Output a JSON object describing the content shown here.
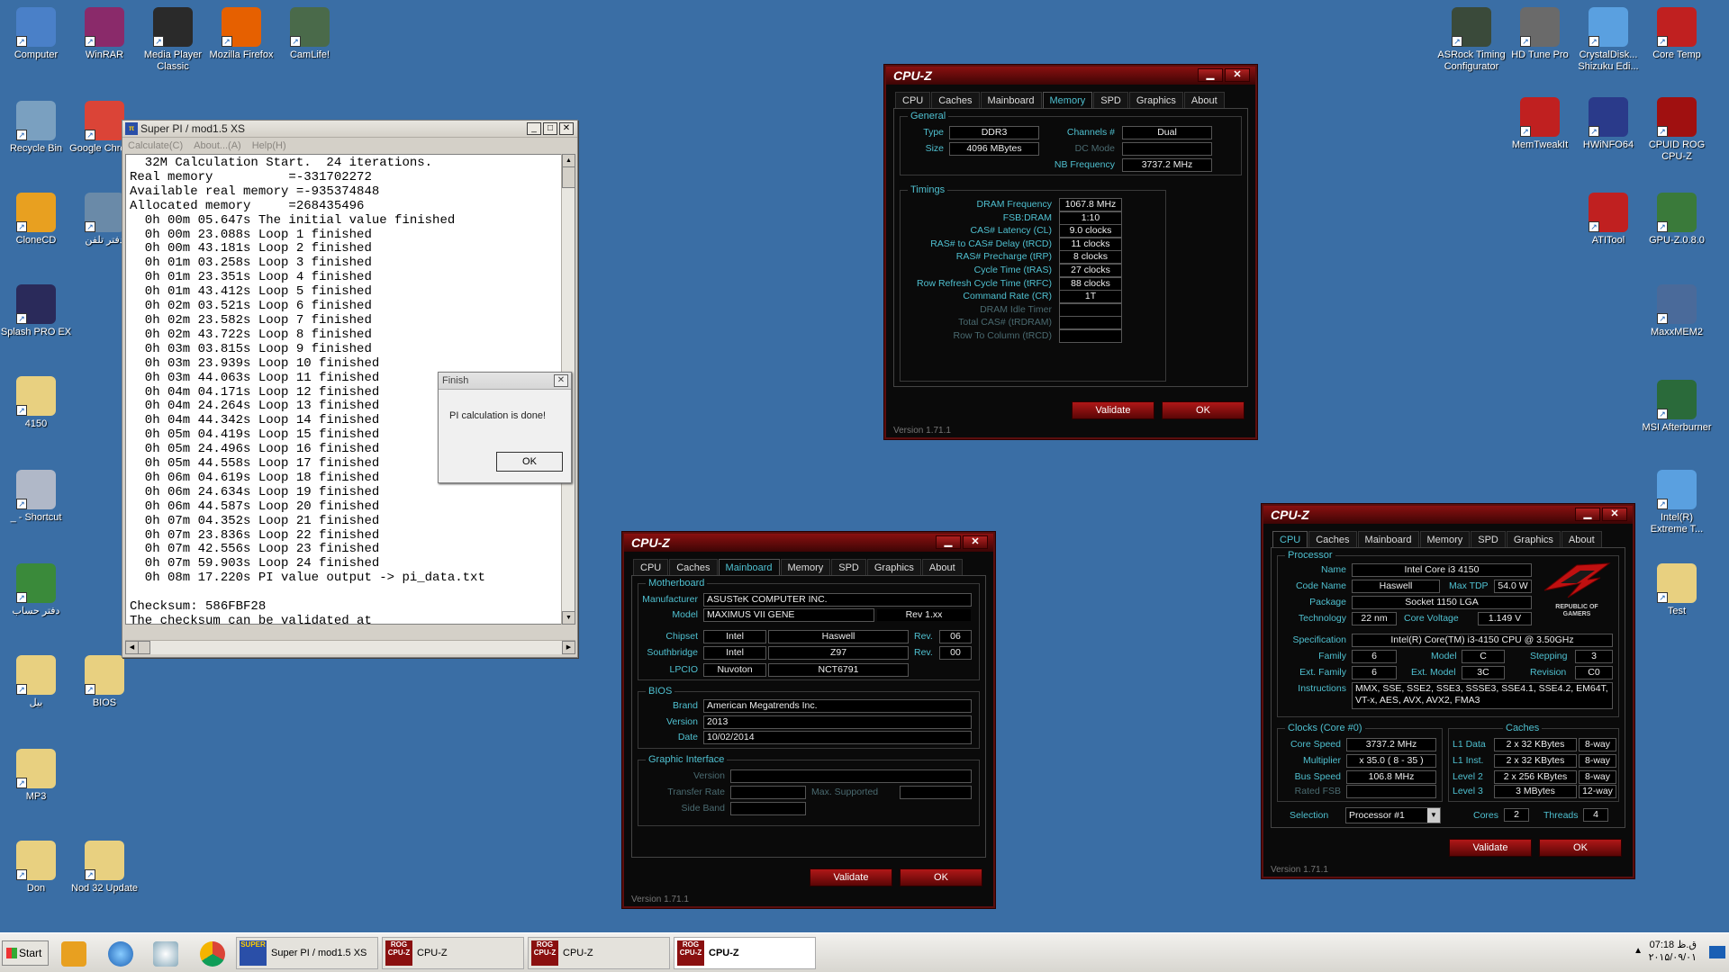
{
  "desktop": {
    "left_icons": [
      {
        "label": "Computer",
        "icon": "computer-icon"
      },
      {
        "label": "WinRAR",
        "icon": "winrar-icon"
      },
      {
        "label": "Media Player Classic",
        "icon": "media-player-icon"
      },
      {
        "label": "Mozilla Firefox",
        "icon": "firefox-icon"
      },
      {
        "label": "CamLife!",
        "icon": "camlife-icon"
      },
      {
        "label": "Recycle Bin",
        "icon": "recycle-bin-icon"
      },
      {
        "label": "Google Chrome",
        "icon": "chrome-icon"
      },
      {
        "label": "CloneCD",
        "icon": "clonecd-icon"
      },
      {
        "label": "دفتر تلفن",
        "icon": "phonebook-icon"
      },
      {
        "label": "Splash PRO EX",
        "icon": "splash-icon"
      },
      {
        "label": "4150",
        "icon": "folder-icon"
      },
      {
        "label": "_ - Shortcut",
        "icon": "shortcut-icon"
      },
      {
        "label": "دفتر حساب",
        "icon": "ledger-icon"
      },
      {
        "label": "بيل",
        "icon": "folder-icon"
      },
      {
        "label": "BIOS",
        "icon": "folder-icon"
      },
      {
        "label": "MP3",
        "icon": "folder-icon"
      },
      {
        "label": "Don",
        "icon": "folder-icon"
      },
      {
        "label": "Nod 32 Update",
        "icon": "folder-icon"
      }
    ],
    "right_icons": [
      {
        "label": "ASRock Timing Configurator",
        "icon": "asrock-icon"
      },
      {
        "label": "HD Tune Pro",
        "icon": "hdtune-icon"
      },
      {
        "label": "CrystalDisk... Shizuku Edi...",
        "icon": "crystaldisk-icon"
      },
      {
        "label": "Core Temp",
        "icon": "coretemp-icon"
      },
      {
        "label": "MemTweakIt",
        "icon": "memtweakit-icon"
      },
      {
        "label": "HWiNFO64",
        "icon": "hwinfo-icon"
      },
      {
        "label": "CPUID ROG CPU-Z",
        "icon": "cpuz-rog-icon"
      },
      {
        "label": "ATITool",
        "icon": "atitool-icon"
      },
      {
        "label": "GPU-Z.0.8.0",
        "icon": "gpuz-icon"
      },
      {
        "label": "MaxxMEM2",
        "icon": "maxxmem-icon"
      },
      {
        "label": "MSI Afterburner",
        "icon": "afterburner-icon"
      },
      {
        "label": "Intel(R) Extreme T...",
        "icon": "intel-xtu-icon"
      },
      {
        "label": "Test",
        "icon": "folder-icon"
      }
    ]
  },
  "superpi": {
    "title": "Super PI / mod1.5 XS",
    "menu": [
      "Calculate(C)",
      "About...(A)",
      "Help(H)"
    ],
    "lines": [
      "  32M Calculation Start.  24 iterations.",
      "Real memory          =-331702272",
      "Available real memory =-935374848",
      "Allocated memory     =268435496",
      "  0h 00m 05.647s The initial value finished",
      "  0h 00m 23.088s Loop 1 finished",
      "  0h 00m 43.181s Loop 2 finished",
      "  0h 01m 03.258s Loop 3 finished",
      "  0h 01m 23.351s Loop 4 finished",
      "  0h 01m 43.412s Loop 5 finished",
      "  0h 02m 03.521s Loop 6 finished",
      "  0h 02m 23.582s Loop 7 finished",
      "  0h 02m 43.722s Loop 8 finished",
      "  0h 03m 03.815s Loop 9 finished",
      "  0h 03m 23.939s Loop 10 finished",
      "  0h 03m 44.063s Loop 11 finished",
      "  0h 04m 04.171s Loop 12 finished",
      "  0h 04m 24.264s Loop 13 finished",
      "  0h 04m 44.342s Loop 14 finished",
      "  0h 05m 04.419s Loop 15 finished",
      "  0h 05m 24.496s Loop 16 finished",
      "  0h 05m 44.558s Loop 17 finished",
      "  0h 06m 04.619s Loop 18 finished",
      "  0h 06m 24.634s Loop 19 finished",
      "  0h 06m 44.587s Loop 20 finished",
      "  0h 07m 04.352s Loop 21 finished",
      "  0h 07m 23.836s Loop 22 finished",
      "  0h 07m 42.556s Loop 23 finished",
      "  0h 07m 59.903s Loop 24 finished",
      "  0h 08m 17.220s PI value output -> pi_data.txt",
      "",
      "Checksum: 586FBF28",
      "The checksum can be validated at"
    ]
  },
  "finish_dialog": {
    "title": "Finish",
    "message": "PI calculation is done!",
    "ok": "OK"
  },
  "cpuz_common": {
    "title": "CPU-Z",
    "tabs": [
      "CPU",
      "Caches",
      "Mainboard",
      "Memory",
      "SPD",
      "Graphics",
      "About"
    ],
    "validate": "Validate",
    "ok": "OK",
    "version": "Version 1.71.1",
    "minimize": "▁",
    "close": "✕"
  },
  "cpuz_memory": {
    "active_tab": "Memory",
    "general_title": "General",
    "type_label": "Type",
    "type": "DDR3",
    "size_label": "Size",
    "size": "4096 MBytes",
    "channels_label": "Channels #",
    "channels": "Dual",
    "dcmode_label": "DC Mode",
    "dcmode": "",
    "nbfreq_label": "NB Frequency",
    "nbfreq": "3737.2 MHz",
    "timings_title": "Timings",
    "timings": [
      {
        "label": "DRAM Frequency",
        "value": "1067.8 MHz",
        "dim": false
      },
      {
        "label": "FSB:DRAM",
        "value": "1:10",
        "dim": false
      },
      {
        "label": "CAS# Latency (CL)",
        "value": "9.0 clocks",
        "dim": false
      },
      {
        "label": "RAS# to CAS# Delay (tRCD)",
        "value": "11 clocks",
        "dim": false
      },
      {
        "label": "RAS# Precharge (tRP)",
        "value": "8 clocks",
        "dim": false
      },
      {
        "label": "Cycle Time (tRAS)",
        "value": "27 clocks",
        "dim": false
      },
      {
        "label": "Row Refresh Cycle Time (tRFC)",
        "value": "88 clocks",
        "dim": false
      },
      {
        "label": "Command Rate (CR)",
        "value": "1T",
        "dim": false
      },
      {
        "label": "DRAM Idle Timer",
        "value": "",
        "dim": true
      },
      {
        "label": "Total CAS# (tRDRAM)",
        "value": "",
        "dim": true
      },
      {
        "label": "Row To Column (tRCD)",
        "value": "",
        "dim": true
      }
    ]
  },
  "cpuz_mainboard": {
    "active_tab": "Mainboard",
    "mb_title": "Motherboard",
    "manufacturer_label": "Manufacturer",
    "manufacturer": "ASUSTeK COMPUTER INC.",
    "model_label": "Model",
    "model": "MAXIMUS VII GENE",
    "model_rev": "Rev 1.xx",
    "chipset_label": "Chipset",
    "chipset_vendor": "Intel",
    "chipset_name": "Haswell",
    "chipset_rev_label": "Rev.",
    "chipset_rev": "06",
    "south_label": "Southbridge",
    "south_vendor": "Intel",
    "south_name": "Z97",
    "south_rev_label": "Rev.",
    "south_rev": "00",
    "lpcio_label": "LPCIO",
    "lpcio_vendor": "Nuvoton",
    "lpcio_name": "NCT6791",
    "bios_title": "BIOS",
    "brand_label": "Brand",
    "brand": "American Megatrends Inc.",
    "version_label": "Version",
    "version": "2013",
    "date_label": "Date",
    "date": "10/02/2014",
    "gi_title": "Graphic Interface",
    "gi_version_label": "Version",
    "gi_transfer_label": "Transfer Rate",
    "gi_max_label": "Max. Supported",
    "gi_sideband_label": "Side Band"
  },
  "cpuz_cpu": {
    "active_tab": "CPU",
    "proc_title": "Processor",
    "name_label": "Name",
    "name": "Intel Core i3 4150",
    "code_label": "Code Name",
    "code": "Haswell",
    "tdp_label": "Max TDP",
    "tdp": "54.0 W",
    "package_label": "Package",
    "package": "Socket 1150 LGA",
    "tech_label": "Technology",
    "tech": "22 nm",
    "voltage_label": "Core Voltage",
    "voltage": "1.149 V",
    "spec_label": "Specification",
    "spec": "Intel(R) Core(TM) i3-4150 CPU @ 3.50GHz",
    "family_label": "Family",
    "family": "6",
    "model_label": "Model",
    "model": "C",
    "stepping_label": "Stepping",
    "stepping": "3",
    "extfamily_label": "Ext. Family",
    "extfamily": "6",
    "extmodel_label": "Ext. Model",
    "extmodel": "3C",
    "revision_label": "Revision",
    "revision": "C0",
    "instr_label": "Instructions",
    "instr1": "MMX, SSE, SSE2, SSE3, SSSE3, SSE4.1, SSE4.2, EM64T,",
    "instr2": "VT-x, AES, AVX, AVX2, FMA3",
    "clocks_title": "Clocks (Core #0)",
    "corespeed_label": "Core Speed",
    "corespeed": "3737.2 MHz",
    "mult_label": "Multiplier",
    "mult": "x 35.0 ( 8 - 35 )",
    "bus_label": "Bus Speed",
    "bus": "106.8 MHz",
    "fsb_label": "Rated FSB",
    "fsb": "",
    "caches_title": "Caches",
    "l1d_label": "L1 Data",
    "l1d": "2 x 32 KBytes",
    "l1d_way": "8-way",
    "l1i_label": "L1 Inst.",
    "l1i": "2 x 32 KBytes",
    "l1i_way": "8-way",
    "l2_label": "Level 2",
    "l2": "2 x 256 KBytes",
    "l2_way": "8-way",
    "l3_label": "Level 3",
    "l3": "3 MBytes",
    "l3_way": "12-way",
    "selection_label": "Selection",
    "selection": "Processor #1",
    "cores_label": "Cores",
    "cores": "2",
    "threads_label": "Threads",
    "threads": "4",
    "rog_line1": "REPUBLIC OF",
    "rog_line2": "GAMERS"
  },
  "taskbar": {
    "start": "Start",
    "buttons": [
      {
        "label": "Super PI / mod1.5 XS",
        "active": false
      },
      {
        "label": "CPU-Z",
        "active": false
      },
      {
        "label": "CPU-Z",
        "active": false
      },
      {
        "label": "CPU-Z",
        "active": true
      }
    ],
    "time": "07:18 ق.ظ",
    "date": "۲۰۱۵/۰۹/۰۱",
    "superpi_icon_text": "SUPER",
    "cpuz_icon_text": "ROG CPU-Z"
  }
}
